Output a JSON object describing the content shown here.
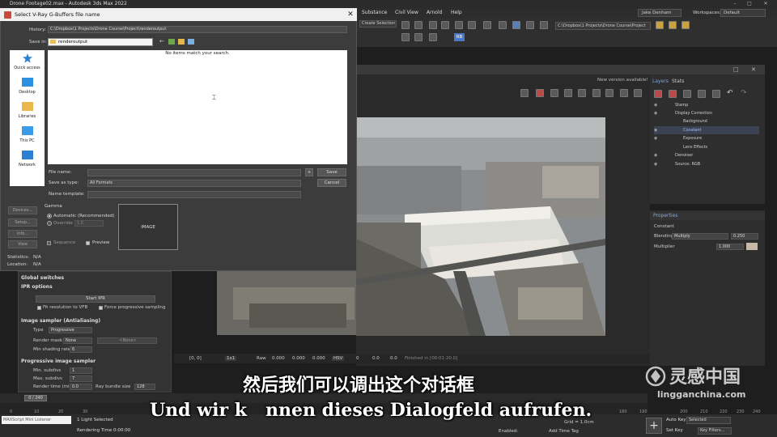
{
  "app": {
    "title": "Drone Footage02.max - Autodesk 3ds Max 2022",
    "menu": [
      "Substance",
      "Civil View",
      "Arnold",
      "Help"
    ],
    "user": "Jake Denham",
    "workspaces_label": "Workspaces:",
    "workspace": "Default",
    "path": "C:\\Dropbox\\1 Projects\\Drone Course\\Project",
    "selection_set": "Create Selection Se",
    "rb_label": "RB"
  },
  "dialog": {
    "title": "Select V-Ray G-Buffers file name",
    "history_label": "History:",
    "history_value": "C:\\Dropbox\\1 Projects\\Drone Course\\Project\\renderoutput",
    "save_in_label": "Save in:",
    "save_in_value": "renderoutput",
    "places": [
      "Quick access",
      "Desktop",
      "Libraries",
      "This PC",
      "Network"
    ],
    "empty_message": "No items match your search.",
    "file_name_label": "File name:",
    "save_as_type_label": "Save as type:",
    "save_as_type_value": "All Formats",
    "name_template_label": "Name template:",
    "save_button": "Save",
    "cancel_button": "Cancel",
    "plus_button": "+",
    "gamma_label": "Gamma",
    "gamma_auto": "Automatic (Recommended)",
    "gamma_override": "Override",
    "gamma_override_value": "1.0",
    "sequence_label": "Sequence",
    "preview_label": "Preview",
    "image_label": "IMAGE",
    "left_buttons": [
      "Devices...",
      "Setup...",
      "Info...",
      "View"
    ],
    "statistics_label": "Statistics:",
    "statistics_value": "N/A",
    "location_label": "Location:",
    "location_value": "N/A"
  },
  "vfb": {
    "new_version": "New version available!",
    "tabs": [
      "Layers",
      "Stats"
    ],
    "layers": [
      {
        "name": "Stamp",
        "indent": 1,
        "selected": false
      },
      {
        "name": "Display Correction",
        "indent": 1,
        "selected": false
      },
      {
        "name": "Background",
        "indent": 2,
        "selected": false
      },
      {
        "name": "Constant",
        "indent": 2,
        "selected": true
      },
      {
        "name": "Exposure",
        "indent": 2,
        "selected": false
      },
      {
        "name": "Lens Effects",
        "indent": 2,
        "selected": false
      },
      {
        "name": "Denoiser",
        "indent": 1,
        "selected": false
      },
      {
        "name": "Source: RGB",
        "indent": 1,
        "selected": false
      }
    ],
    "properties_label": "Properties",
    "prop_name": "Constant",
    "blending_label": "Blending",
    "blending_value": "Multiply",
    "blending_amount": "0.250",
    "multiplier_label": "Multiplier",
    "multiplier_value": "1.000",
    "status_coord": "[0, 0]",
    "status_mode": "1x1",
    "status_raw": "Raw",
    "status_values": [
      "0.000",
      "0.000",
      "0.000"
    ],
    "status_color": "HSV",
    "status_hsv": [
      "0",
      "0.0",
      "0.0"
    ],
    "status_finished": "Finished in [00:01:20.0]"
  },
  "render_settings": {
    "global_switches": "Global switches",
    "ipr_options": "IPR options",
    "start_ipr": "Start IPR",
    "fit_resolution": "Fit resolution to VFB",
    "force_progressive": "Force progressive sampling",
    "image_sampler": "Image sampler (Antialiasing)",
    "type_label": "Type",
    "type_value": "Progressive",
    "render_mask_label": "Render mask",
    "render_mask_value": "None",
    "none_placeholder": "<None>",
    "min_shading_label": "Min shading rate",
    "min_shading_value": "6",
    "progressive_sampler": "Progressive image sampler",
    "min_subdivs_label": "Min. subdivs",
    "min_subdivs_value": "1",
    "max_subdivs_label": "Max. subdivs",
    "max_subdivs_value": "7",
    "render_time_label": "Render time (min)",
    "render_time_value": "0.0",
    "ray_bundle_label": "Ray bundle size",
    "ray_bundle_value": "128"
  },
  "timeline": {
    "slider": "0 / 240",
    "ticks": [
      "0",
      "10",
      "20",
      "30",
      "180",
      "190",
      "200",
      "210",
      "220",
      "230",
      "240"
    ],
    "maxscript": "MAXScript Mini Listener",
    "lights_selected": "1 Light Selected",
    "rendering_time": "Rendering Time 0:00:00",
    "grid": "Grid = 1.0cm",
    "auto_key": "Auto Key",
    "selected": "Selected",
    "set_key": "Set Key",
    "key_filters": "Key Filters...",
    "enabled": "Enabled:",
    "add_time_tag": "Add Time Tag"
  },
  "subtitles": {
    "chinese": "然后我们可以调出这个对话框",
    "german": "Und wir k   nnen dieses Dialogfeld aufrufen."
  },
  "watermark": {
    "brand": "灵感中国",
    "url": "lingganchina.com"
  }
}
